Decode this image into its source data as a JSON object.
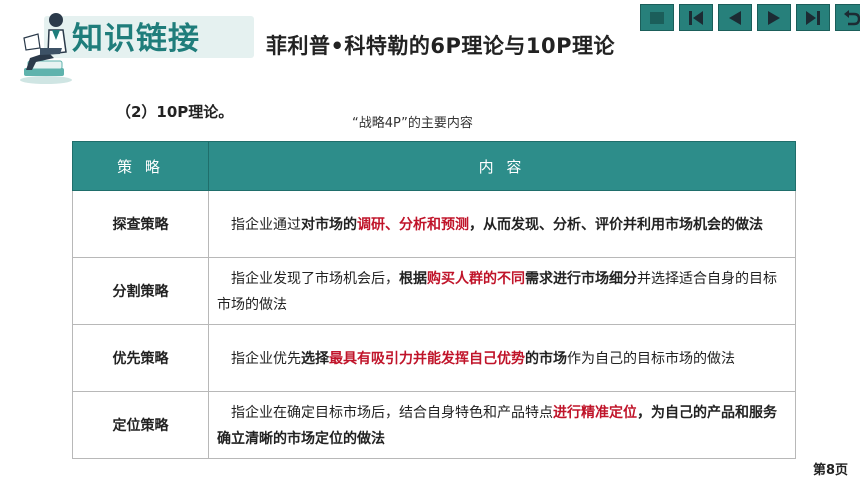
{
  "header": {
    "brand": "知识链接",
    "title": "菲利普•科特勒的6P理论与10P理论"
  },
  "nav": {
    "buttons": [
      "home",
      "first",
      "prev",
      "next",
      "last",
      "exit"
    ]
  },
  "subheading": "（2）10P理论。",
  "caption": "“战略4P”的主要内容",
  "table": {
    "headers": [
      "策 略",
      "内 容"
    ],
    "rows": [
      {
        "name": "探查策略",
        "parts": [
          {
            "t": "指企业通过",
            "s": "n"
          },
          {
            "t": "对市场的",
            "s": "b"
          },
          {
            "t": "调研、分析和预测",
            "s": "r"
          },
          {
            "t": "，从而发现、分析、评价并利用市场机会的做法",
            "s": "b"
          }
        ]
      },
      {
        "name": "分割策略",
        "parts": [
          {
            "t": "指企业发现了市场机会后，",
            "s": "n"
          },
          {
            "t": "根据",
            "s": "b"
          },
          {
            "t": "购买人群的不同",
            "s": "r"
          },
          {
            "t": "需求进行市场细分",
            "s": "b"
          },
          {
            "t": "并选择适合自身的目标市场的做法",
            "s": "n"
          }
        ]
      },
      {
        "name": "优先策略",
        "parts": [
          {
            "t": "指企业优先",
            "s": "n"
          },
          {
            "t": "选择",
            "s": "b"
          },
          {
            "t": "最具有吸引力并能发挥自己优势",
            "s": "r"
          },
          {
            "t": "的市场",
            "s": "b"
          },
          {
            "t": "作为自己的目标市场的做法",
            "s": "n"
          }
        ]
      },
      {
        "name": "定位策略",
        "parts": [
          {
            "t": "指企业在确定目标市场后，结合自身特色和产品特点",
            "s": "n"
          },
          {
            "t": "进行精准定位",
            "s": "r"
          },
          {
            "t": "，为自己的产品和服务确立清晰的市场定位的做法",
            "s": "b"
          }
        ]
      }
    ]
  },
  "page_number": "第8页",
  "colors": {
    "teal": "#2d8d8a",
    "brand": "#1f7d7b",
    "highlight_red": "#c0142a"
  }
}
